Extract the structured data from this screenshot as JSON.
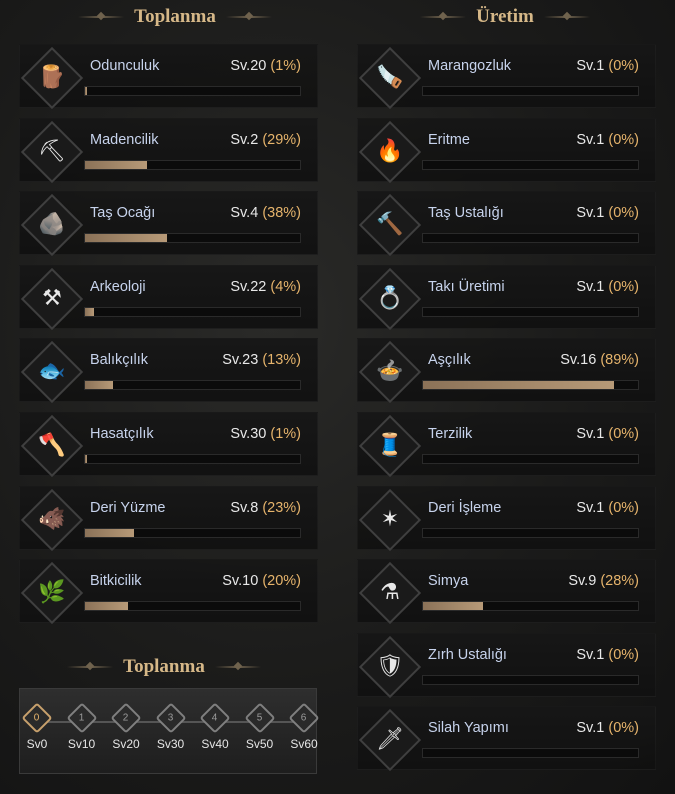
{
  "headers": {
    "gathering": "Toplanma",
    "crafting": "Üretim",
    "milestones": "Toplanma"
  },
  "colors": {
    "accent": "#e6b46c",
    "name": "#c7d3ec",
    "bar": "#b79a78"
  },
  "gathering": [
    {
      "key": "odunculuk",
      "label": "Odunculuk",
      "level": "Sv.20",
      "percent": "(1%)",
      "progress": 0.01,
      "icon": "log-pile-icon",
      "glyph": "🪵"
    },
    {
      "key": "madencilik",
      "label": "Madencilik",
      "level": "Sv.2",
      "percent": "(29%)",
      "progress": 0.29,
      "icon": "pickaxe-icon",
      "glyph": "⛏"
    },
    {
      "key": "tas-ocagi",
      "label": "Taş Ocağı",
      "level": "Sv.4",
      "percent": "(38%)",
      "progress": 0.38,
      "icon": "stone-block-icon",
      "glyph": "🪨"
    },
    {
      "key": "arkeoloji",
      "label": "Arkeoloji",
      "level": "Sv.22",
      "percent": "(4%)",
      "progress": 0.04,
      "icon": "shovel-icon",
      "glyph": "⚒"
    },
    {
      "key": "balikcilik",
      "label": "Balıkçılık",
      "level": "Sv.23",
      "percent": "(13%)",
      "progress": 0.13,
      "icon": "fish-icon",
      "glyph": "🐟"
    },
    {
      "key": "hasatcilik",
      "label": "Hasatçılık",
      "level": "Sv.30",
      "percent": "(1%)",
      "progress": 0.01,
      "icon": "sickle-icon",
      "glyph": "🪓"
    },
    {
      "key": "deri-yuzme",
      "label": "Deri Yüzme",
      "level": "Sv.8",
      "percent": "(23%)",
      "progress": 0.23,
      "icon": "boar-icon",
      "glyph": "🐗"
    },
    {
      "key": "bitkicilik",
      "label": "Bitkicilik",
      "level": "Sv.10",
      "percent": "(20%)",
      "progress": 0.2,
      "icon": "herb-icon",
      "glyph": "🌿"
    }
  ],
  "crafting": [
    {
      "key": "marangozluk",
      "label": "Marangozluk",
      "level": "Sv.1",
      "percent": "(0%)",
      "progress": 0.0,
      "icon": "saw-icon",
      "glyph": "🪚"
    },
    {
      "key": "eritme",
      "label": "Eritme",
      "level": "Sv.1",
      "percent": "(0%)",
      "progress": 0.0,
      "icon": "furnace-icon",
      "glyph": "🔥"
    },
    {
      "key": "tas-ustaligi",
      "label": "Taş Ustalığı",
      "level": "Sv.1",
      "percent": "(0%)",
      "progress": 0.0,
      "icon": "chisel-icon",
      "glyph": "🔨"
    },
    {
      "key": "taki-uretimi",
      "label": "Takı Üretimi",
      "level": "Sv.1",
      "percent": "(0%)",
      "progress": 0.0,
      "icon": "jewel-icon",
      "glyph": "💍"
    },
    {
      "key": "ascilik",
      "label": "Aşçılık",
      "level": "Sv.16",
      "percent": "(89%)",
      "progress": 0.89,
      "icon": "cauldron-icon",
      "glyph": "🍲"
    },
    {
      "key": "terzilik",
      "label": "Terzilik",
      "level": "Sv.1",
      "percent": "(0%)",
      "progress": 0.0,
      "icon": "needle-thread-icon",
      "glyph": "🧵"
    },
    {
      "key": "deri-isleme",
      "label": "Deri İşleme",
      "level": "Sv.1",
      "percent": "(0%)",
      "progress": 0.0,
      "icon": "hide-icon",
      "glyph": "✶"
    },
    {
      "key": "simya",
      "label": "Simya",
      "level": "Sv.9",
      "percent": "(28%)",
      "progress": 0.28,
      "icon": "mortar-pestle-icon",
      "glyph": "⚗"
    },
    {
      "key": "zirh-ustaligi",
      "label": "Zırh Ustalığı",
      "level": "Sv.1",
      "percent": "(0%)",
      "progress": 0.0,
      "icon": "armor-icon",
      "glyph": "🛡"
    },
    {
      "key": "silah-yapimi",
      "label": "Silah Yapımı",
      "level": "Sv.1",
      "percent": "(0%)",
      "progress": 0.0,
      "icon": "sword-icon",
      "glyph": "🗡"
    }
  ],
  "milestones": [
    {
      "num": "0",
      "label": "Sv0",
      "active": true
    },
    {
      "num": "1",
      "label": "Sv10",
      "active": false
    },
    {
      "num": "2",
      "label": "Sv20",
      "active": false
    },
    {
      "num": "3",
      "label": "Sv30",
      "active": false
    },
    {
      "num": "4",
      "label": "Sv40",
      "active": false
    },
    {
      "num": "5",
      "label": "Sv50",
      "active": false
    },
    {
      "num": "6",
      "label": "Sv60",
      "active": false
    }
  ]
}
